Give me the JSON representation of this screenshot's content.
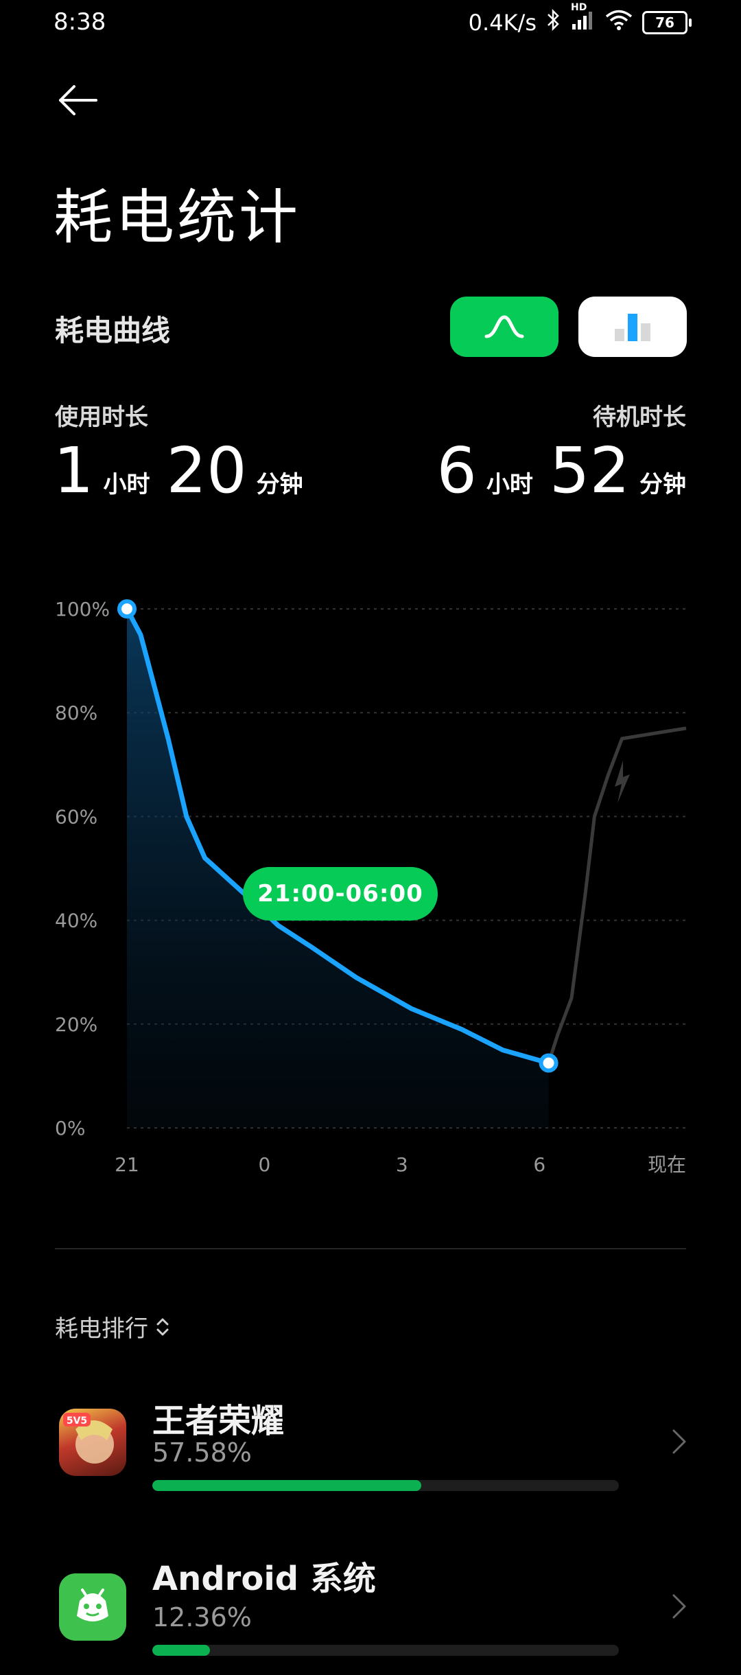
{
  "status": {
    "time": "8:38",
    "speed": "0.4K/s",
    "hd": "HD",
    "battery": "76"
  },
  "header": {
    "title": "耗电统计"
  },
  "curve_section": {
    "title": "耗电曲线"
  },
  "stats": {
    "usage": {
      "label": "使用时长",
      "hours": "1",
      "hours_unit": "小时",
      "minutes": "20",
      "minutes_unit": "分钟"
    },
    "standby": {
      "label": "待机时长",
      "hours": "6",
      "hours_unit": "小时",
      "minutes": "52",
      "minutes_unit": "分钟"
    }
  },
  "colors": {
    "accent": "#06cc57",
    "line": "#1aa3ff",
    "charge_line": "#3a3a3a"
  },
  "chart_data": {
    "type": "line",
    "y_ticks": [
      "100%",
      "80%",
      "60%",
      "40%",
      "20%",
      "0%"
    ],
    "x_ticks": [
      "21",
      "0",
      "3",
      "6",
      "现在"
    ],
    "ylim": [
      0,
      100
    ],
    "grid": true,
    "selection_label": "21:00-06:00",
    "series": [
      {
        "x": [
          21.0,
          21.3,
          21.6,
          21.9,
          22.3,
          22.7,
          23.2,
          23.7,
          24.3,
          25.0,
          26.0,
          27.2,
          28.3,
          29.2,
          30.0,
          30.2
        ],
        "values": [
          100,
          95,
          85,
          75,
          60,
          52,
          48,
          44,
          39,
          35,
          29,
          23,
          19,
          15,
          13,
          12.5
        ]
      },
      {
        "x": [
          30.2,
          30.4,
          30.7,
          31.0,
          31.2,
          31.5,
          31.8,
          32.5,
          33.2
        ],
        "values": [
          12.5,
          18,
          25,
          45,
          60,
          68,
          75,
          76,
          77
        ]
      }
    ]
  },
  "ranking": {
    "label": "耗电排行",
    "apps": [
      {
        "name": "王者荣耀",
        "percent": "57.58%",
        "value": 57.58
      },
      {
        "name": "Android 系统",
        "percent": "12.36%",
        "value": 12.36
      }
    ]
  }
}
